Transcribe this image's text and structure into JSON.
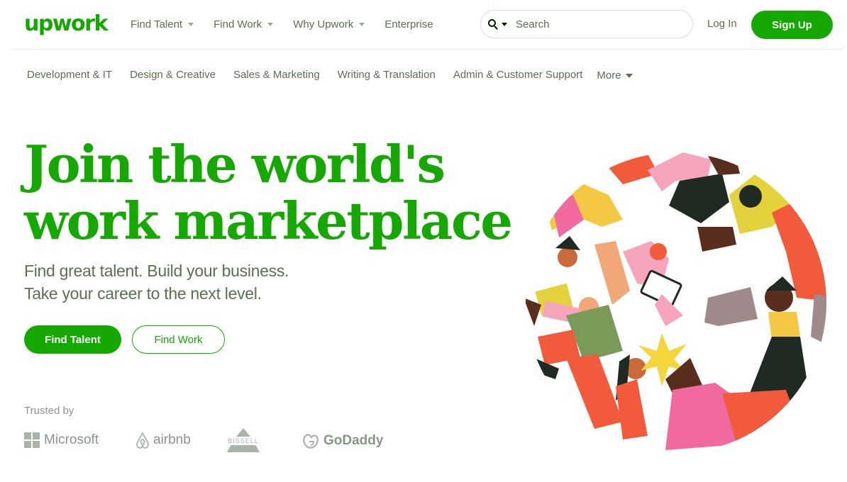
{
  "brand": {
    "logo_text": "upwork",
    "accent": "#14a800",
    "text_muted": "#5e6d55"
  },
  "topnav": {
    "links": [
      {
        "label": "Find Talent",
        "has_caret": true
      },
      {
        "label": "Find Work",
        "has_caret": true
      },
      {
        "label": "Why Upwork",
        "has_caret": true
      },
      {
        "label": "Enterprise",
        "has_caret": false
      }
    ],
    "search": {
      "placeholder": "Search",
      "icon": "search-icon"
    },
    "login_label": "Log In",
    "signup_label": "Sign Up"
  },
  "categories": {
    "items": [
      "Development & IT",
      "Design & Creative",
      "Sales & Marketing",
      "Writing & Translation",
      "Admin & Customer Support"
    ],
    "more_label": "More"
  },
  "hero": {
    "headline_line1": "Join the world's",
    "headline_line2": "work marketplace",
    "sub_line1": "Find great talent. Build your business.",
    "sub_line2": "Take your career to the next level.",
    "cta_primary": "Find Talent",
    "cta_secondary": "Find Work"
  },
  "trusted": {
    "label": "Trusted by",
    "logos": [
      "Microsoft",
      "airbnb",
      "BISSELL",
      "GoDaddy"
    ]
  },
  "illustration": {
    "icon": "people-circle-illustration"
  }
}
